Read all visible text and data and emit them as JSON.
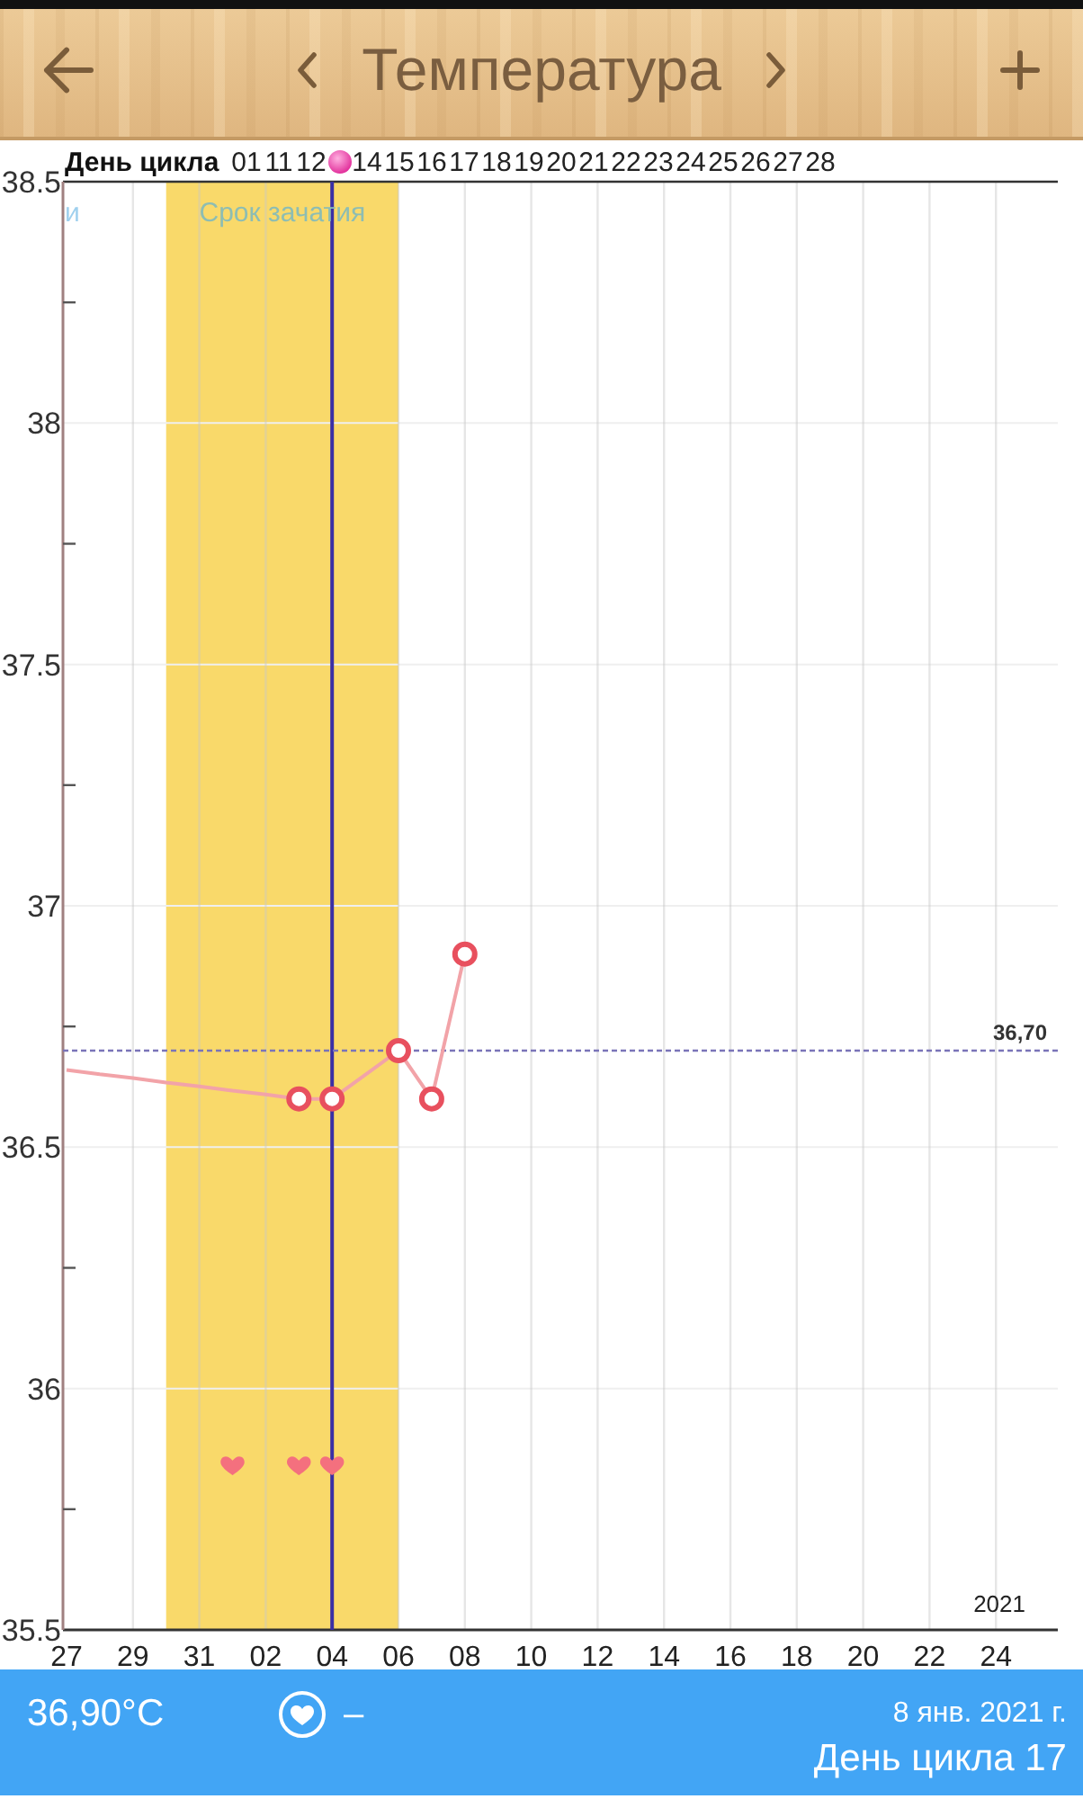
{
  "header": {
    "title": "Температура"
  },
  "chart": {
    "cycle_day_row": {
      "label": "День цикла",
      "days": [
        {
          "kind": "day",
          "label": "01"
        },
        {
          "kind": "day",
          "label": "11"
        },
        {
          "kind": "day",
          "label": "12"
        },
        {
          "kind": "ovulation"
        },
        {
          "kind": "day",
          "label": "14"
        },
        {
          "kind": "day",
          "label": "15"
        },
        {
          "kind": "day",
          "label": "16"
        },
        {
          "kind": "day",
          "label": "17"
        },
        {
          "kind": "day",
          "label": "18"
        },
        {
          "kind": "day",
          "label": "19"
        },
        {
          "kind": "day",
          "label": "20"
        },
        {
          "kind": "day",
          "label": "21"
        },
        {
          "kind": "day",
          "label": "22"
        },
        {
          "kind": "day",
          "label": "23"
        },
        {
          "kind": "day",
          "label": "24"
        },
        {
          "kind": "day",
          "label": "25"
        },
        {
          "kind": "day",
          "label": "26"
        },
        {
          "kind": "day",
          "label": "27"
        },
        {
          "kind": "day",
          "label": "28"
        }
      ]
    },
    "year_label": "2021",
    "chart_data": {
      "type": "line",
      "grid": true,
      "categories": [
        "27",
        null,
        "29",
        null,
        "31",
        null,
        "02",
        null,
        "04",
        null,
        "06",
        null,
        "08",
        null,
        "10",
        null,
        "12",
        null,
        "14",
        null,
        "16",
        null,
        "18",
        null,
        "20",
        null,
        "22",
        null,
        "24",
        null
      ],
      "series": [
        {
          "name": "Срок зачатия",
          "type": "area",
          "color": "#f9d96a",
          "values": [
            null,
            null,
            null,
            38.5,
            38.5,
            38.5,
            38.5,
            38.5,
            38.5,
            38.5,
            38.5,
            null,
            null,
            null,
            null,
            null,
            null,
            null,
            null,
            null,
            null,
            null,
            null,
            null,
            null,
            null,
            null,
            null,
            null,
            null
          ]
        },
        {
          "color": "#f2a3a8",
          "marker": "none",
          "values": [
            36.66,
            36.651,
            36.643,
            36.634,
            36.626,
            36.617,
            36.609,
            36.6,
            36.6,
            36.65,
            36.7,
            36.6,
            36.9,
            null,
            null,
            null,
            null,
            null,
            null,
            null,
            null,
            null,
            null,
            null,
            null,
            null,
            null,
            null,
            null,
            null
          ]
        },
        {
          "color": "#e8505e",
          "type": "scatter",
          "marker": "circle",
          "values": [
            null,
            null,
            null,
            null,
            null,
            null,
            null,
            36.6,
            36.6,
            null,
            36.7,
            36.6,
            36.9,
            null,
            null,
            null,
            null,
            null,
            null,
            null,
            null,
            null,
            null,
            null,
            null,
            null,
            null,
            null,
            null,
            null
          ]
        },
        {
          "color": "#f4707e",
          "type": "scatter",
          "values": [
            null,
            null,
            null,
            null,
            null,
            35.84,
            null,
            35.84,
            35.84,
            null,
            null,
            null,
            null,
            null,
            null,
            null,
            null,
            null,
            null,
            null,
            null,
            null,
            null,
            null,
            null,
            null,
            null,
            null,
            null,
            null
          ]
        }
      ],
      "ylim": [
        35.5,
        38.5
      ],
      "yticks": [
        35.5,
        36,
        36.5,
        37,
        37.5,
        38,
        38.5
      ],
      "ref_lines": [
        {
          "axis": "x",
          "value": "04"
        },
        {
          "axis": "y",
          "value": 36.7,
          "label": "36,70"
        }
      ],
      "annotations": [
        "и"
      ]
    }
  },
  "footer": {
    "temperature": "36,90°C",
    "heart_note": "–",
    "date": "8 янв. 2021 г.",
    "cycle_day": "День цикла 17"
  }
}
